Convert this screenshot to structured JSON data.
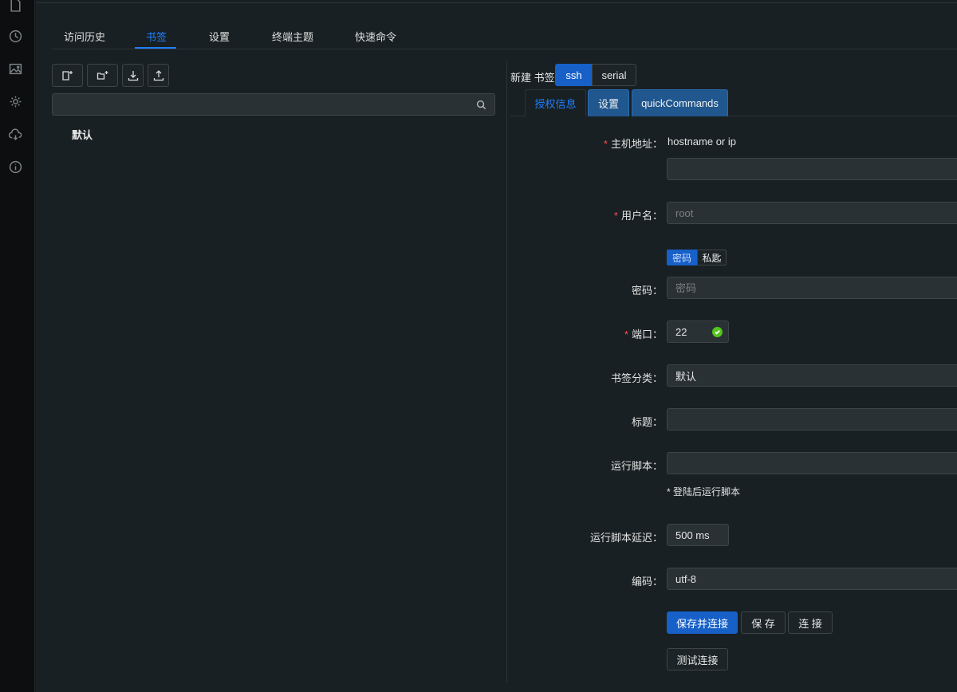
{
  "sidebar": {
    "icons": [
      "file-icon",
      "history-icon",
      "image-icon",
      "gear-icon",
      "cloud-sync-icon",
      "info-icon"
    ]
  },
  "tabs": [
    {
      "label": "访问历史"
    },
    {
      "label": "书签"
    },
    {
      "label": "设置"
    },
    {
      "label": "终端主题"
    },
    {
      "label": "快速命令"
    }
  ],
  "active_tab": "书签",
  "search": {
    "value": "",
    "placeholder": ""
  },
  "tree": {
    "items": [
      {
        "label": "默认"
      }
    ]
  },
  "bookmark_form": {
    "new_label": "新建 书签",
    "types": [
      {
        "label": "ssh"
      },
      {
        "label": "serial"
      }
    ],
    "selected_type": "ssh",
    "form_tabs": [
      {
        "label": "授权信息"
      },
      {
        "label": "设置"
      },
      {
        "label": "quickCommands"
      }
    ],
    "active_form_tab": "授权信息",
    "host": {
      "label": "主机地址",
      "hint": "hostname or ip",
      "value": ""
    },
    "username": {
      "label": "用户名",
      "placeholder": "root"
    },
    "auth_types": [
      {
        "label": "密码"
      },
      {
        "label": "私匙"
      }
    ],
    "selected_auth": "密码",
    "password": {
      "label": "密码",
      "placeholder": "密码"
    },
    "port": {
      "label": "端口",
      "value": "22"
    },
    "category": {
      "label": "书签分类",
      "value": "默认"
    },
    "title": {
      "label": "标题",
      "value": ""
    },
    "run_script": {
      "label": "运行脚本",
      "value": "",
      "hint": "* 登陆后运行脚本"
    },
    "run_script_delay": {
      "label": "运行脚本延迟",
      "value": "500 ms"
    },
    "encoding": {
      "label": "编码",
      "value": "utf-8"
    },
    "buttons": {
      "save_connect": "保存并连接",
      "save": "保 存",
      "connect": "连 接",
      "test": "测试连接"
    }
  },
  "colors": {
    "accent": "#1760c8",
    "link": "#1f7fff",
    "required": "#ff4d4f",
    "ok": "#52c41a"
  }
}
